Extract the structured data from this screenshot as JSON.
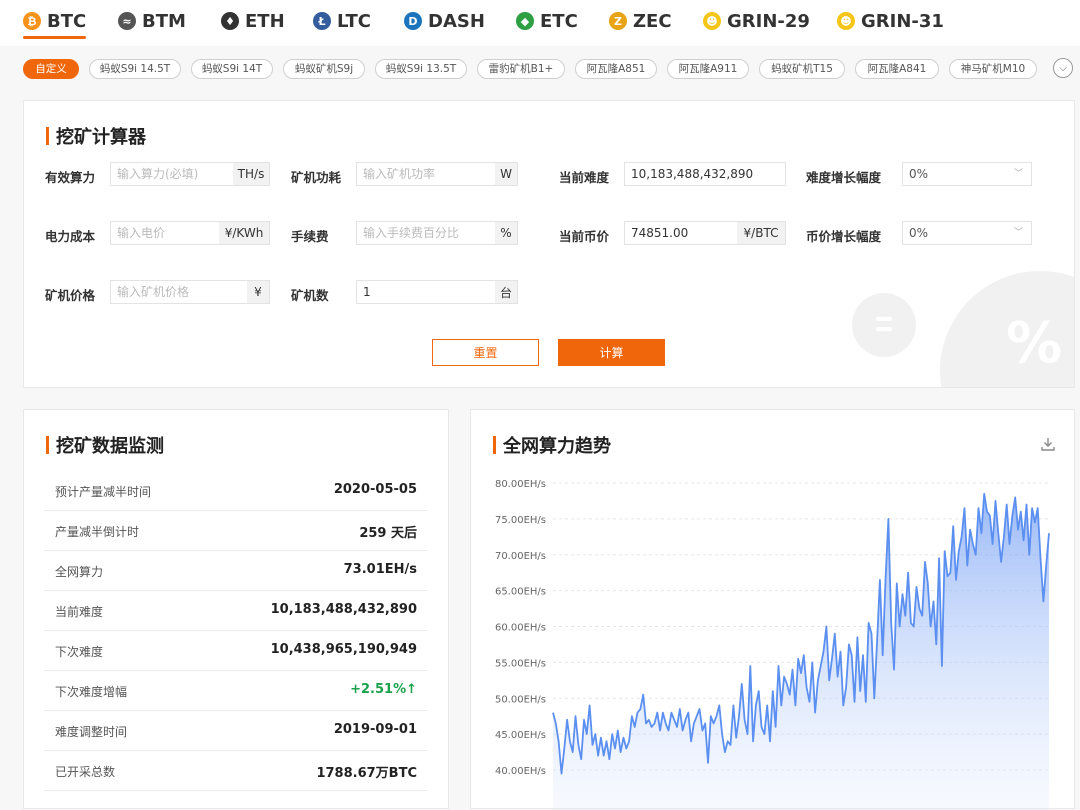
{
  "coin_tabs": [
    {
      "label": "BTC",
      "icon": "bitcoin-icon",
      "color": "#f7931a",
      "glyph": "₿",
      "active": true
    },
    {
      "label": "BTM",
      "icon": "bytom-icon",
      "color": "#555555",
      "glyph": "≈",
      "active": false
    },
    {
      "label": "ETH",
      "icon": "ethereum-icon",
      "color": "#333333",
      "glyph": "♦",
      "active": false
    },
    {
      "label": "LTC",
      "icon": "litecoin-icon",
      "color": "#345d9d",
      "glyph": "Ł",
      "active": false
    },
    {
      "label": "DASH",
      "icon": "dash-icon",
      "color": "#1c75bc",
      "glyph": "D",
      "active": false
    },
    {
      "label": "ETC",
      "icon": "ethereum-classic-icon",
      "color": "#2ea043",
      "glyph": "◆",
      "active": false
    },
    {
      "label": "ZEC",
      "icon": "zcash-icon",
      "color": "#e8a317",
      "glyph": "Z",
      "active": false
    },
    {
      "label": "GRIN-29",
      "icon": "grin-icon",
      "color": "#f5c518",
      "glyph": "☻",
      "active": false
    },
    {
      "label": "GRIN-31",
      "icon": "grin-icon",
      "color": "#f5c518",
      "glyph": "☻",
      "active": false
    }
  ],
  "miner_chips": [
    "自定义",
    "蚂蚁S9i 14.5T",
    "蚂蚁S9i 14T",
    "蚂蚁矿机S9j",
    "蚂蚁S9i 13.5T",
    "雷豹矿机B1+",
    "阿瓦隆A851",
    "阿瓦隆A911",
    "蚂蚁矿机T15",
    "阿瓦隆A841",
    "神马矿机M10"
  ],
  "calculator": {
    "title": "挖矿计算器",
    "hashrate": {
      "label": "有效算力",
      "placeholder": "输入算力(必填)",
      "unit": "TH/s"
    },
    "power": {
      "label": "矿机功耗",
      "placeholder": "输入矿机功率",
      "unit": "W"
    },
    "difficulty": {
      "label": "当前难度",
      "value": "10,183,488,432,890"
    },
    "difficulty_growth": {
      "label": "难度增长幅度",
      "value": "0%"
    },
    "electricity": {
      "label": "电力成本",
      "placeholder": "输入电价",
      "unit": "¥/KWh"
    },
    "fee": {
      "label": "手续费",
      "placeholder": "输入手续费百分比",
      "unit": "%"
    },
    "price": {
      "label": "当前币价",
      "value": "74851.00",
      "unit": "¥/BTC"
    },
    "price_growth": {
      "label": "币价增长幅度",
      "value": "0%"
    },
    "miner_price": {
      "label": "矿机价格",
      "placeholder": "输入矿机价格",
      "unit": "¥"
    },
    "miner_count": {
      "label": "矿机数",
      "value": "1",
      "unit": "台"
    },
    "reset_label": "重置",
    "calc_label": "计算"
  },
  "monitor": {
    "title": "挖矿数据监测",
    "rows": [
      {
        "key": "预计产量减半时间",
        "value": "2020-05-05"
      },
      {
        "key": "产量减半倒计时",
        "value": "259 天后"
      },
      {
        "key": "全网算力",
        "value": "73.01EH/s"
      },
      {
        "key": "当前难度",
        "value": "10,183,488,432,890"
      },
      {
        "key": "下次难度",
        "value": "10,438,965,190,949"
      },
      {
        "key": "下次难度增幅",
        "value": "+2.51%↑"
      },
      {
        "key": "难度调整时间",
        "value": "2019-09-01"
      },
      {
        "key": "已开采总数",
        "value": "1788.67万BTC"
      }
    ]
  },
  "trend": {
    "title": "全网算力趋势"
  },
  "chart_data": {
    "type": "area",
    "title": "全网算力趋势",
    "unit": "EH/s",
    "ylim": [
      37,
      80
    ],
    "yticks": [
      40,
      45,
      50,
      55,
      60,
      65,
      70,
      75,
      80
    ],
    "ytick_labels": [
      "40.00EH/s",
      "45.00EH/s",
      "50.00EH/s",
      "55.00EH/s",
      "60.00EH/s",
      "65.00EH/s",
      "70.00EH/s",
      "75.00EH/s",
      "80.00EH/s"
    ],
    "grid": true,
    "line_color": "#5b8ff0",
    "values": [
      48.0,
      46.5,
      44.0,
      39.5,
      43.0,
      47.0,
      44.0,
      42.5,
      47.5,
      43.5,
      41.5,
      47.0,
      45.0,
      49.0,
      43.5,
      45.0,
      42.0,
      44.5,
      42.0,
      44.0,
      41.5,
      45.0,
      43.0,
      45.5,
      42.5,
      44.5,
      43.0,
      44.0,
      47.5,
      46.0,
      48.0,
      48.5,
      50.5,
      46.5,
      47.0,
      46.0,
      46.5,
      48.0,
      45.5,
      48.0,
      46.5,
      45.5,
      48.0,
      47.0,
      46.0,
      48.5,
      45.5,
      47.0,
      48.0,
      44.0,
      46.5,
      47.5,
      48.5,
      45.5,
      46.5,
      41.0,
      47.5,
      46.5,
      47.5,
      49.0,
      45.0,
      42.5,
      44.0,
      43.5,
      49.0,
      44.5,
      47.5,
      52.0,
      47.0,
      45.0,
      54.5,
      44.0,
      49.0,
      51.0,
      46.0,
      45.0,
      49.0,
      44.0,
      51.0,
      46.0,
      54.5,
      49.0,
      53.0,
      52.0,
      50.5,
      54.0,
      49.0,
      55.5,
      53.5,
      56.0,
      51.5,
      49.5,
      55.0,
      48.0,
      52.5,
      54.5,
      56.5,
      60.0,
      52.5,
      55.5,
      59.0,
      53.0,
      56.5,
      49.0,
      51.5,
      57.5,
      56.0,
      49.5,
      58.5,
      51.0,
      56.0,
      49.5,
      60.5,
      59.0,
      50.0,
      58.0,
      66.5,
      56.0,
      66.5,
      75.0,
      60.5,
      54.0,
      66.0,
      60.0,
      64.5,
      61.5,
      67.5,
      60.5,
      60.0,
      65.5,
      62.5,
      61.5,
      69.0,
      66.0,
      60.0,
      63.5,
      57.5,
      69.5,
      54.5,
      70.5,
      67.0,
      67.5,
      74.0,
      66.5,
      70.5,
      72.5,
      76.5,
      68.5,
      73.5,
      71.5,
      70.0,
      76.5,
      73.0,
      78.5,
      76.0,
      75.5,
      71.5,
      77.5,
      73.0,
      69.0,
      72.5,
      77.0,
      71.5,
      75.5,
      78.0,
      73.5,
      76.0,
      72.0,
      77.0,
      70.0,
      76.5,
      74.5,
      76.5,
      69.5,
      63.5,
      68.5,
      73.0
    ]
  }
}
